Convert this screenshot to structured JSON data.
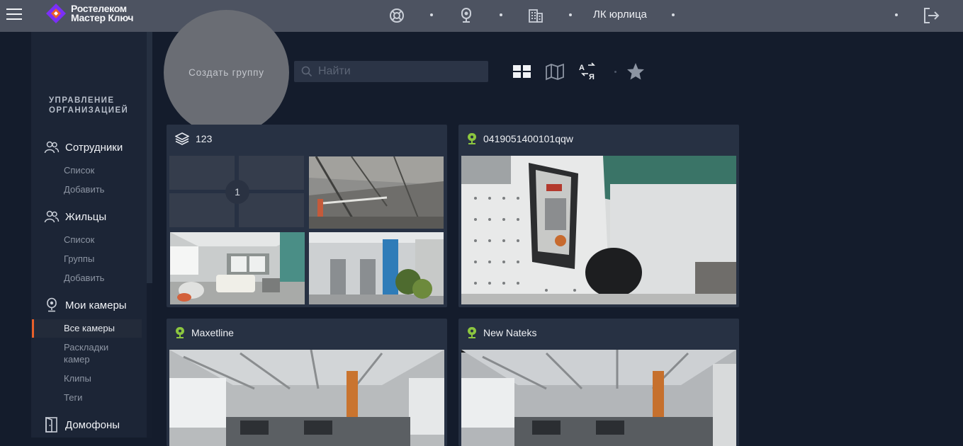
{
  "topbar": {
    "logo_line1": "Ростелеком",
    "logo_line2": "Мастер Ключ",
    "account_label": "ЛК юрлица",
    "icons": [
      "support-icon",
      "camera-icon",
      "building-icon",
      "logout-icon"
    ]
  },
  "sidebar": {
    "org_title": "УПРАВЛЕНИЕ ОРГАНИЗАЦИЕЙ",
    "sections": [
      {
        "label": "Сотрудники",
        "icon": "people-icon",
        "items": [
          "Список",
          "Добавить"
        ]
      },
      {
        "label": "Жильцы",
        "icon": "people-icon",
        "items": [
          "Список",
          "Группы",
          "Добавить"
        ]
      },
      {
        "label": "Мои камеры",
        "icon": "camera-icon",
        "items": [
          "Все камеры",
          "Раскладки камер",
          "Клипы",
          "Теги"
        ],
        "active_item": "Все камеры"
      },
      {
        "label": "Домофоны",
        "icon": "intercom-door-icon",
        "items": []
      }
    ]
  },
  "toolbar": {
    "create_group": "Создать группу",
    "search_placeholder": "Найти",
    "view_icons": [
      "grid-view-icon",
      "map-view-icon",
      "sort-az-icon",
      "favorite-star-icon"
    ]
  },
  "cards": [
    {
      "title": "123",
      "type": "group",
      "empty_count": "1"
    },
    {
      "title": "0419051400101qqw",
      "type": "camera"
    },
    {
      "title": "Maxetline",
      "type": "camera"
    },
    {
      "title": "New Nateks",
      "type": "camera"
    }
  ],
  "colors": {
    "topbar": "#4d5361",
    "background": "#141c2c",
    "sidebar": "#1c2536",
    "card": "#273143",
    "accent": "#e8602a",
    "camera_green": "#8cc63f"
  }
}
